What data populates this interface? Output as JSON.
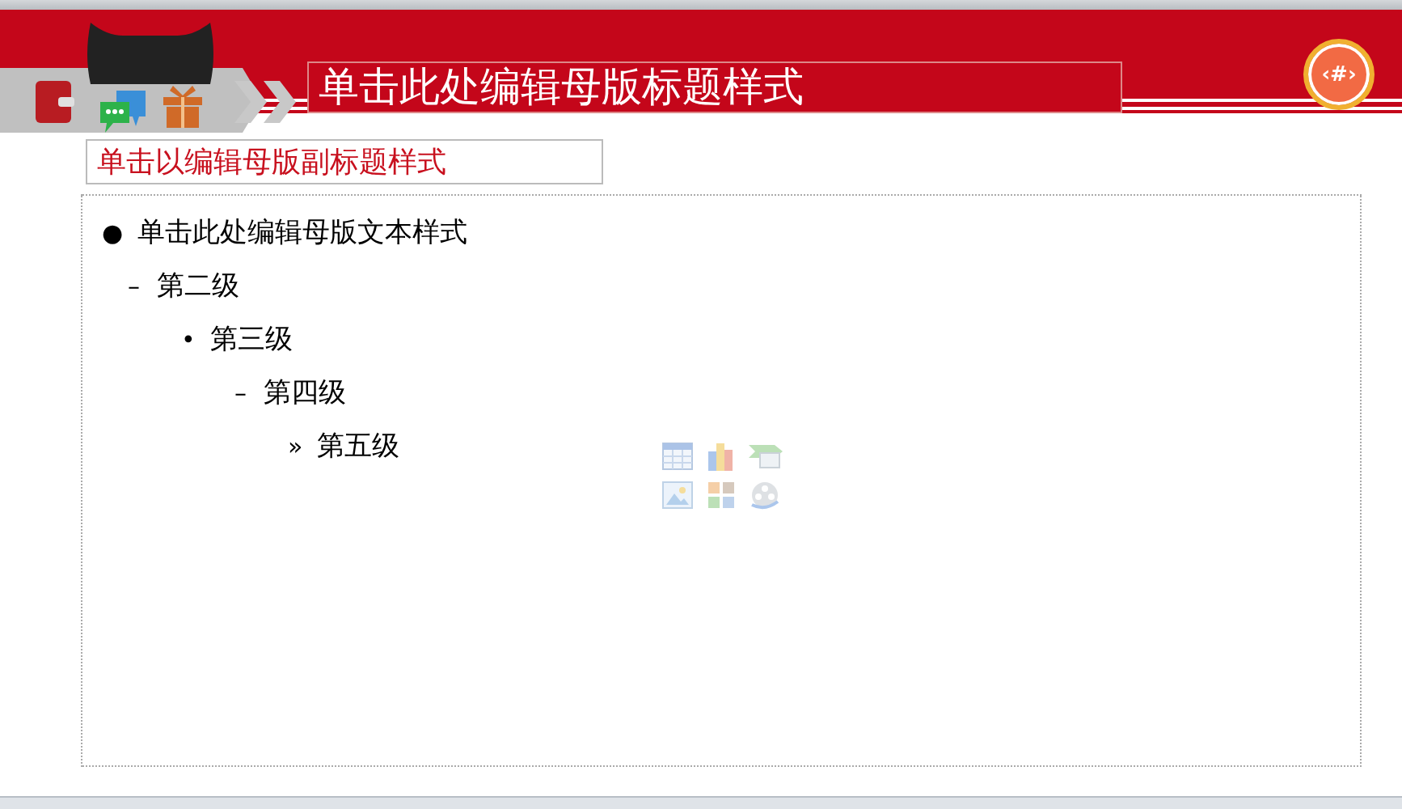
{
  "slide_number": "‹#›",
  "title": "单击此处编辑母版标题样式",
  "subtitle": "单击以编辑母版副标题样式",
  "body": [
    {
      "bullet": "●",
      "text": "单击此处编辑母版文本样式",
      "children": [
        {
          "bullet": "–",
          "text": "第二级",
          "children": [
            {
              "bullet": "•",
              "text": "第三级",
              "children": [
                {
                  "bullet": "–",
                  "text": "第四级",
                  "children": [
                    {
                      "bullet": "»",
                      "text": "第五级"
                    }
                  ]
                }
              ]
            }
          ]
        }
      ]
    }
  ]
}
